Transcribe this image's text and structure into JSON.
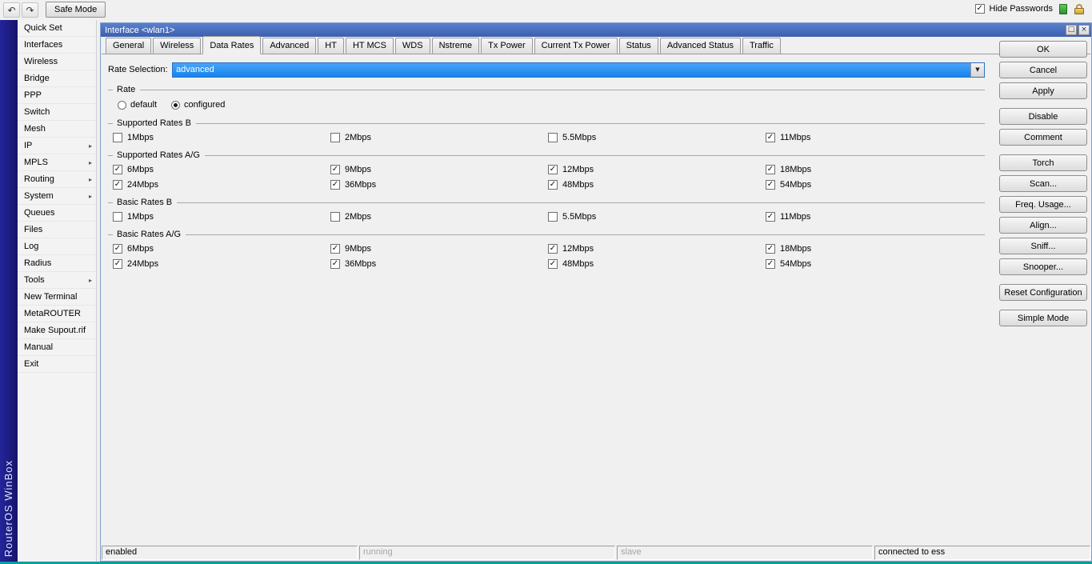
{
  "colors": {
    "titlebar_top": "#5a80cc",
    "titlebar_bottom": "#3c5fae",
    "selection_blue_top": "#4aa4f8",
    "selection_blue_bottom": "#1583ee",
    "sidebar_strip": "#24249a",
    "bottom_edge": "#00a0a0"
  },
  "icons": {
    "undo": "↶",
    "redo": "↷",
    "check": "✓",
    "dropdown_arrow": "▼",
    "submenu_arrow": "▸",
    "titlebar_restore": "□",
    "titlebar_close": "×"
  },
  "toolbar": {
    "safe_mode_label": "Safe Mode",
    "hide_passwords_label": "Hide Passwords",
    "hide_passwords_checked": true
  },
  "sidebar": {
    "brand": "RouterOS WinBox",
    "items": [
      {
        "label": "Quick Set",
        "arrow": false
      },
      {
        "label": "Interfaces",
        "arrow": false
      },
      {
        "label": "Wireless",
        "arrow": false
      },
      {
        "label": "Bridge",
        "arrow": false
      },
      {
        "label": "PPP",
        "arrow": false
      },
      {
        "label": "Switch",
        "arrow": false
      },
      {
        "label": "Mesh",
        "arrow": false
      },
      {
        "label": "IP",
        "arrow": true
      },
      {
        "label": "MPLS",
        "arrow": true
      },
      {
        "label": "Routing",
        "arrow": true
      },
      {
        "label": "System",
        "arrow": true
      },
      {
        "label": "Queues",
        "arrow": false
      },
      {
        "label": "Files",
        "arrow": false
      },
      {
        "label": "Log",
        "arrow": false
      },
      {
        "label": "Radius",
        "arrow": false
      },
      {
        "label": "Tools",
        "arrow": true
      },
      {
        "label": "New Terminal",
        "arrow": false
      },
      {
        "label": "MetaROUTER",
        "arrow": false
      },
      {
        "label": "Make Supout.rif",
        "arrow": false
      },
      {
        "label": "Manual",
        "arrow": false
      },
      {
        "label": "Exit",
        "arrow": false
      }
    ]
  },
  "dialog": {
    "title": "Interface <wlan1>",
    "tabs": [
      "General",
      "Wireless",
      "Data Rates",
      "Advanced",
      "HT",
      "HT MCS",
      "WDS",
      "Nstreme",
      "Tx Power",
      "Current Tx Power",
      "Status",
      "Advanced Status",
      "Traffic"
    ],
    "active_tab": "Data Rates",
    "rate_selection": {
      "label": "Rate Selection:",
      "value": "advanced"
    },
    "rate_group": {
      "title": "Rate",
      "options": [
        {
          "label": "default",
          "selected": false
        },
        {
          "label": "configured",
          "selected": true
        }
      ]
    },
    "groups": [
      {
        "title": "Supported Rates B",
        "items": [
          {
            "label": "1Mbps",
            "checked": false
          },
          {
            "label": "2Mbps",
            "checked": false
          },
          {
            "label": "5.5Mbps",
            "checked": false
          },
          {
            "label": "11Mbps",
            "checked": true
          }
        ]
      },
      {
        "title": "Supported Rates A/G",
        "items": [
          {
            "label": "6Mbps",
            "checked": true
          },
          {
            "label": "9Mbps",
            "checked": true
          },
          {
            "label": "12Mbps",
            "checked": true
          },
          {
            "label": "18Mbps",
            "checked": true
          },
          {
            "label": "24Mbps",
            "checked": true
          },
          {
            "label": "36Mbps",
            "checked": true
          },
          {
            "label": "48Mbps",
            "checked": true
          },
          {
            "label": "54Mbps",
            "checked": true
          }
        ]
      },
      {
        "title": "Basic Rates B",
        "items": [
          {
            "label": "1Mbps",
            "checked": false
          },
          {
            "label": "2Mbps",
            "checked": false
          },
          {
            "label": "5.5Mbps",
            "checked": false
          },
          {
            "label": "11Mbps",
            "checked": true
          }
        ]
      },
      {
        "title": "Basic Rates A/G",
        "items": [
          {
            "label": "6Mbps",
            "checked": true
          },
          {
            "label": "9Mbps",
            "checked": true
          },
          {
            "label": "12Mbps",
            "checked": true
          },
          {
            "label": "18Mbps",
            "checked": true
          },
          {
            "label": "24Mbps",
            "checked": true
          },
          {
            "label": "36Mbps",
            "checked": true
          },
          {
            "label": "48Mbps",
            "checked": true
          },
          {
            "label": "54Mbps",
            "checked": true
          }
        ]
      }
    ],
    "buttons": [
      "OK",
      "Cancel",
      "Apply",
      "Disable",
      "Comment",
      "Torch",
      "Scan...",
      "Freq. Usage...",
      "Align...",
      "Sniff...",
      "Snooper...",
      "Reset Configuration",
      "Simple Mode"
    ],
    "status_bar": [
      {
        "label": "enabled",
        "muted": false
      },
      {
        "label": "running",
        "muted": true
      },
      {
        "label": "slave",
        "muted": true
      },
      {
        "label": "connected to ess",
        "muted": false
      }
    ]
  }
}
